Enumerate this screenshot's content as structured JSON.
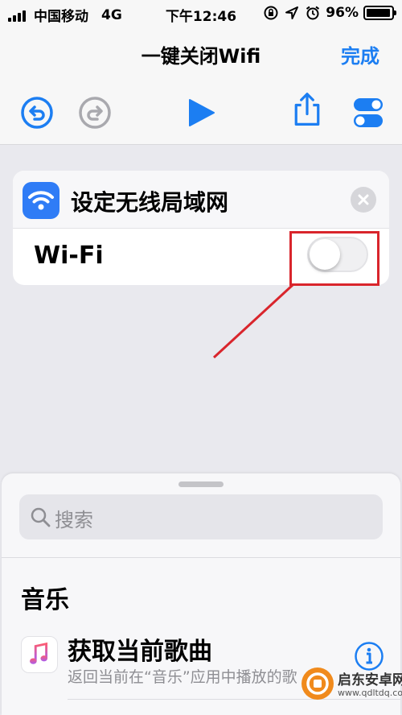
{
  "status_bar": {
    "carrier": "中国移动",
    "network": "4G",
    "time": "下午12:46",
    "battery": "96%",
    "battery_level": 0.96
  },
  "nav": {
    "title": "一键关闭Wifi",
    "done_label": "完成",
    "toolbar": [
      "undo-icon",
      "redo-icon",
      "play-icon",
      "share-icon",
      "settings-toggle-icon"
    ]
  },
  "action": {
    "title": "设定无线局域网",
    "row_label": "Wi-Fi",
    "toggle_on": false,
    "accent_color": "#2f7cf6"
  },
  "annotation": {
    "color": "#d9252c"
  },
  "sheet": {
    "search_placeholder": "搜索",
    "section_title": "音乐",
    "items": [
      {
        "title": "获取当前歌曲",
        "description": "返回当前在“音乐”应用中播放的歌"
      }
    ]
  },
  "watermark": {
    "text": "启东安卓网",
    "url": "www.qdltdq.com"
  },
  "colors": {
    "tint": "#1c7ef2",
    "background": "#e9e9ee",
    "disabled": "#a9a9ae"
  }
}
